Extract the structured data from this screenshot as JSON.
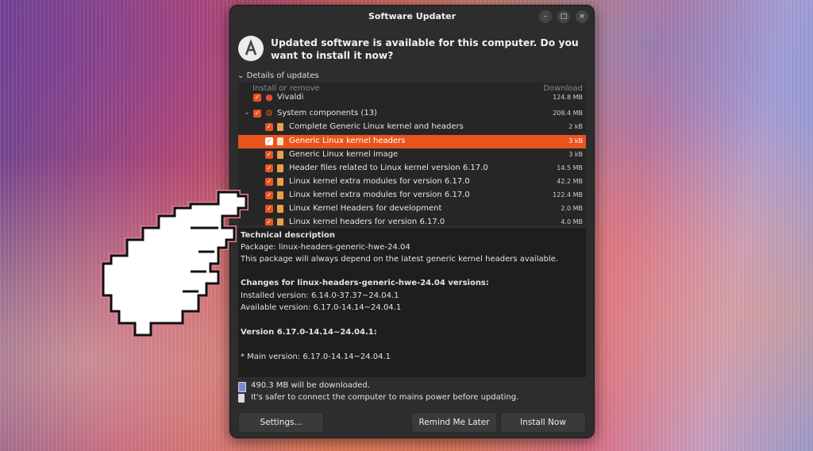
{
  "window": {
    "title": "Software Updater",
    "controls": {
      "minimize": "–",
      "maximize": "□",
      "close": "×"
    },
    "header_message": "Updated software is available for this computer. Do you want to install it now?",
    "details_label": "Details of updates",
    "list": {
      "col_install": "Install or remove",
      "col_download": "Download",
      "rows": [
        {
          "label": "Vivaldi",
          "size": "124.8 MB"
        },
        {
          "label": "System components (13)",
          "size": "208.4 MB"
        },
        {
          "label": "Complete Generic Linux kernel and headers",
          "size": "2 kB"
        },
        {
          "label": "Generic Linux kernel headers",
          "size": "3 kB"
        },
        {
          "label": "Generic Linux kernel image",
          "size": "3 kB"
        },
        {
          "label": "Header files related to Linux kernel version 6.17.0",
          "size": "14.5 MB"
        },
        {
          "label": "Linux kernel extra modules for version 6.17.0",
          "size": "42.2 MB"
        },
        {
          "label": "Linux kernel extra modules for version 6.17.0",
          "size": "122.4 MB"
        },
        {
          "label": "Linux Kernel Headers for development",
          "size": "2.0 MB"
        },
        {
          "label": "Linux kernel headers for version 6.17.0",
          "size": "4.0 MB"
        }
      ]
    },
    "description": {
      "heading": "Technical description",
      "package": "Package: linux-headers-generic-hwe-24.04",
      "summary": "This package will always depend on the latest generic kernel headers available.",
      "changes_heading": "Changes for linux-headers-generic-hwe-24.04 versions:",
      "installed": "Installed version: 6.14.0-37.37~24.04.1",
      "available": "Available version: 6.17.0-14.14~24.04.1",
      "version_heading": "Version 6.17.0-14.14~24.04.1:",
      "main_version": "* Main version: 6.17.0-14.14~24.04.1"
    },
    "download_info": "490.3 MB will be downloaded.",
    "power_info": "It's safer to connect the computer to mains power before updating.",
    "buttons": {
      "settings": "Settings...",
      "remind": "Remind Me Later",
      "install": "Install Now"
    },
    "colors": {
      "accent": "#e9541e",
      "window_bg": "#2d2d2d"
    },
    "icons": {
      "app": "software-updater-icon",
      "pointer": "pointing-hand-icon"
    }
  }
}
